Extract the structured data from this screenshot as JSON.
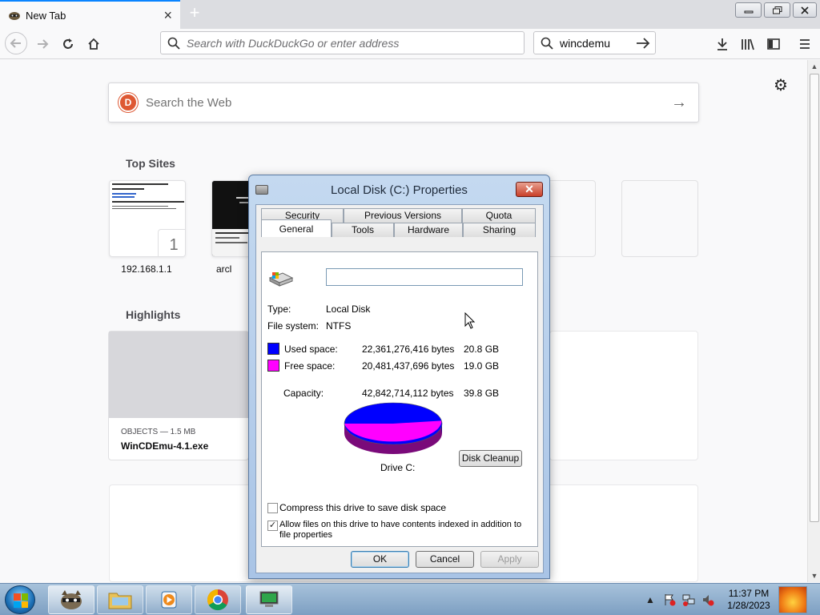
{
  "browser": {
    "tab_title": "New Tab",
    "new_tab_symbol": "+",
    "url_placeholder": "Search with DuckDuckGo or enter address",
    "search_value": "wincdemu"
  },
  "newtab": {
    "search_placeholder": "Search the Web",
    "top_sites_title": "Top Sites",
    "sites": [
      {
        "label": "192.168.1.1",
        "badge": "1"
      },
      {
        "label": "arcl"
      }
    ],
    "highlights_title": "Highlights",
    "highlight": {
      "meta": "OBJECTS — 1.5 MB",
      "name": "WinCDEmu-4.1.exe"
    }
  },
  "dialog": {
    "title": "Local Disk (C:) Properties",
    "tabs_back": [
      "Security",
      "Previous Versions",
      "Quota"
    ],
    "tabs_front": [
      "General",
      "Tools",
      "Hardware",
      "Sharing"
    ],
    "type_label": "Type:",
    "type_value": "Local Disk",
    "fs_label": "File system:",
    "fs_value": "NTFS",
    "used_label": "Used space:",
    "used_bytes": "22,361,276,416 bytes",
    "used_gb": "20.8 GB",
    "free_label": "Free space:",
    "free_bytes": "20,481,437,696 bytes",
    "free_gb": "19.0 GB",
    "capacity_label": "Capacity:",
    "capacity_bytes": "42,842,714,112 bytes",
    "capacity_gb": "39.8 GB",
    "drive_label": "Drive C:",
    "cleanup_button": "Disk Cleanup",
    "compress_label": "Compress this drive to save disk space",
    "index_label_1": "Allow files on this drive to have contents indexed in addition to",
    "index_label_2": "file properties",
    "ok_button": "OK",
    "cancel_button": "Cancel",
    "apply_button": "Apply",
    "colors": {
      "used": "#0000ff",
      "free": "#ff00ff"
    },
    "used_fraction": 0.522
  },
  "taskbar": {
    "time": "11:37 PM",
    "date": "1/28/2023"
  }
}
